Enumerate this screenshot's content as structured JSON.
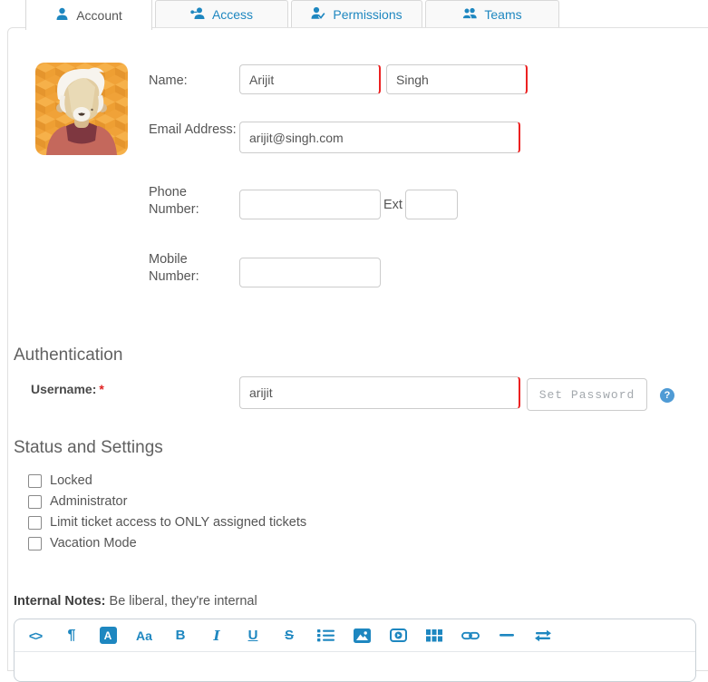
{
  "tabs": [
    {
      "label": "Account",
      "active": true
    },
    {
      "label": "Access",
      "active": false
    },
    {
      "label": "Permissions",
      "active": false
    },
    {
      "label": "Teams",
      "active": false
    }
  ],
  "form": {
    "name_label": "Name:",
    "first_name": "Arijit",
    "last_name": "Singh",
    "email_label": "Email Address:",
    "email": "arijit@singh.com",
    "phone_label": "Phone Number:",
    "phone_value": "",
    "ext_label": "Ext",
    "ext_value": "",
    "mobile_label": "Mobile Number:",
    "mobile_value": ""
  },
  "auth": {
    "heading": "Authentication",
    "username_label": "Username:",
    "required_mark": "*",
    "username": "arijit",
    "set_password_label": "Set Password",
    "help_glyph": "?"
  },
  "status": {
    "heading": "Status and Settings",
    "options": [
      {
        "label": "Locked",
        "checked": false
      },
      {
        "label": "Administrator",
        "checked": false
      },
      {
        "label": "Limit ticket access to ONLY assigned tickets",
        "checked": false
      },
      {
        "label": "Vacation Mode",
        "checked": false
      }
    ]
  },
  "notes": {
    "label": "Internal Notes:",
    "hint": "Be liberal, they're internal"
  },
  "toolbar": {
    "glyphs": {
      "code": "<>",
      "paragraph": "¶",
      "highlight": "A",
      "font": "Aa",
      "bold": "B",
      "italic": "I",
      "underline": "U",
      "strikethrough": "S"
    },
    "icon_names": [
      "code-view-icon",
      "paragraph-icon",
      "font-color-icon",
      "font-size-icon",
      "bold-icon",
      "italic-icon",
      "underline-icon",
      "strikethrough-icon",
      "unordered-list-icon",
      "insert-image-icon",
      "insert-video-icon",
      "insert-table-icon",
      "insert-link-icon",
      "horizontal-line-icon",
      "swap-arrows-icon"
    ]
  },
  "colors": {
    "accent": "#1e87c0",
    "error_border": "#ec2121",
    "help_blue": "#4f9bd5",
    "avatar_bg": "#f0a238"
  }
}
